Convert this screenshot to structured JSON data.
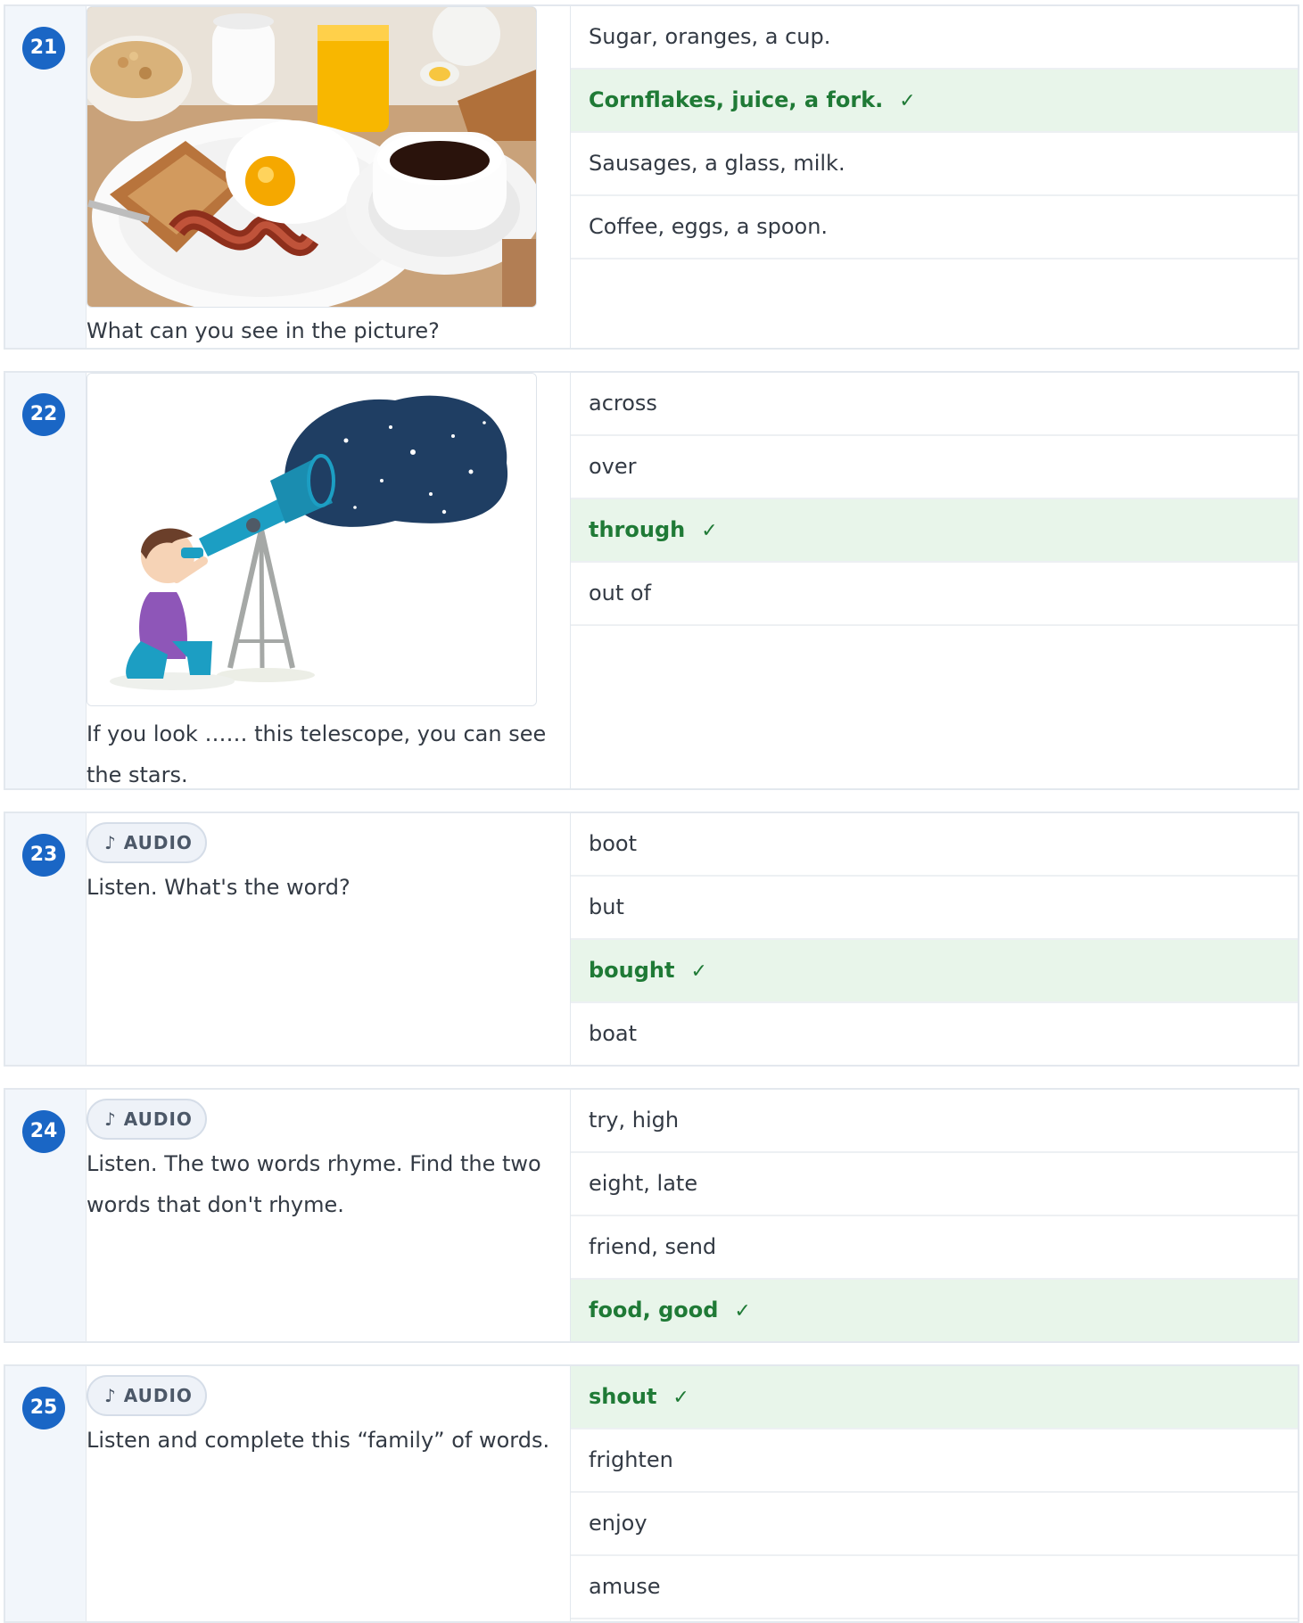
{
  "questions": [
    {
      "number": "21",
      "image": "breakfast-photo",
      "prompt": "What can you see in the picture?",
      "options": [
        {
          "text": "Sugar, oranges, a cup.",
          "correct": false
        },
        {
          "text": "Cornflakes, juice, a fork.",
          "correct": true
        },
        {
          "text": "Sausages, a glass, milk.",
          "correct": false
        },
        {
          "text": "Coffee, eggs, a spoon.",
          "correct": false
        }
      ]
    },
    {
      "number": "22",
      "image": "telescope-illustration",
      "prompt": "If you look …… this telescope, you can see the stars.",
      "options": [
        {
          "text": "across",
          "correct": false
        },
        {
          "text": "over",
          "correct": false
        },
        {
          "text": "through",
          "correct": true
        },
        {
          "text": "out of",
          "correct": false
        }
      ]
    },
    {
      "number": "23",
      "audio_label": "AUDIO",
      "audio_icon": "music-note-icon",
      "prompt": "Listen. What's the word?",
      "options": [
        {
          "text": "boot",
          "correct": false
        },
        {
          "text": "but",
          "correct": false
        },
        {
          "text": "bought",
          "correct": true
        },
        {
          "text": "boat",
          "correct": false
        }
      ]
    },
    {
      "number": "24",
      "audio_label": "AUDIO",
      "audio_icon": "music-note-icon",
      "prompt": "Listen. The two words rhyme. Find the two words that don't rhyme.",
      "options": [
        {
          "text": "try, high",
          "correct": false
        },
        {
          "text": "eight, late",
          "correct": false
        },
        {
          "text": "friend, send",
          "correct": false
        },
        {
          "text": "food, good",
          "correct": true
        }
      ]
    },
    {
      "number": "25",
      "audio_label": "AUDIO",
      "audio_icon": "music-note-icon",
      "prompt": "Listen and complete this “family” of words.",
      "options": [
        {
          "text": "shout",
          "correct": true
        },
        {
          "text": "frighten",
          "correct": false
        },
        {
          "text": "enjoy",
          "correct": false
        },
        {
          "text": "amuse",
          "correct": false
        }
      ]
    }
  ],
  "check_mark": "✓",
  "note_glyph": "♪",
  "colors": {
    "accent": "#1a66c5",
    "correct_bg": "#e8f5ea",
    "correct_text": "#1f7a36",
    "left_column_bg": "#f2f6fb"
  }
}
